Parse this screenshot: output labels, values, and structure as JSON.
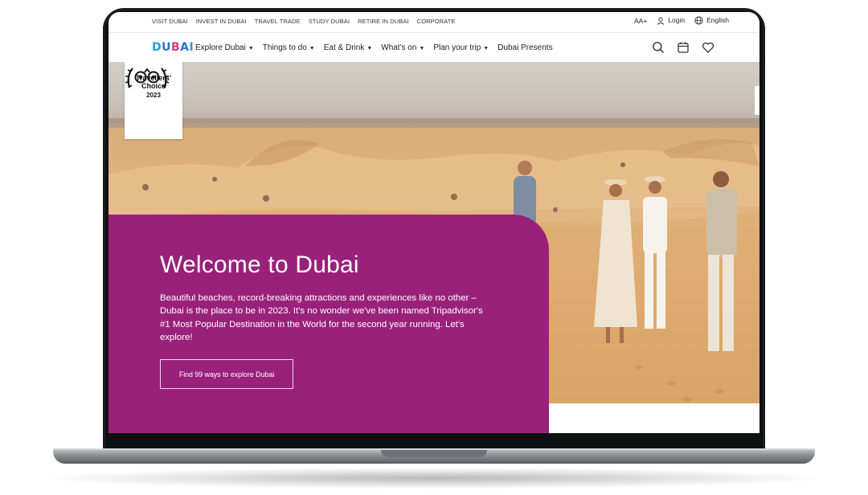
{
  "utility_nav": {
    "links": [
      "VISIT DUBAI",
      "INVEST IN DUBAI",
      "TRAVEL TRADE",
      "STUDY DUBAI",
      "RETIRE IN DUBAI",
      "CORPORATE"
    ],
    "font_size_label": "AA+",
    "login_label": "Login",
    "language_label": "English"
  },
  "main_nav": {
    "logo_text": "DUBAI",
    "items": [
      {
        "label": "Explore Dubai",
        "dropdown": true
      },
      {
        "label": "Things to do",
        "dropdown": true
      },
      {
        "label": "Eat & Drink",
        "dropdown": true
      },
      {
        "label": "What's on",
        "dropdown": true
      },
      {
        "label": "Plan your trip",
        "dropdown": true
      },
      {
        "label": "Dubai Presents",
        "dropdown": false
      }
    ],
    "icons": [
      "search-icon",
      "calendar-icon",
      "heart-icon"
    ]
  },
  "badge": {
    "line1": "Travellers'",
    "line2": "Choice",
    "year": "2023"
  },
  "hero": {
    "title": "Welcome to Dubai",
    "description": "Beautiful beaches, record-breaking attractions and experiences like no other – Dubai is the place to be in 2023. It's no wonder we've been named Tripadvisor's #1 Most Popular Destination in the World for the second year running. Let's explore!",
    "cta_label": "Find 99 ways to explore Dubai",
    "panel_color": "#9a217b"
  },
  "colors": {
    "brand_blue": "#1f9bd7",
    "brand_pink": "#d63b82",
    "hero_purple": "#9a217b"
  }
}
